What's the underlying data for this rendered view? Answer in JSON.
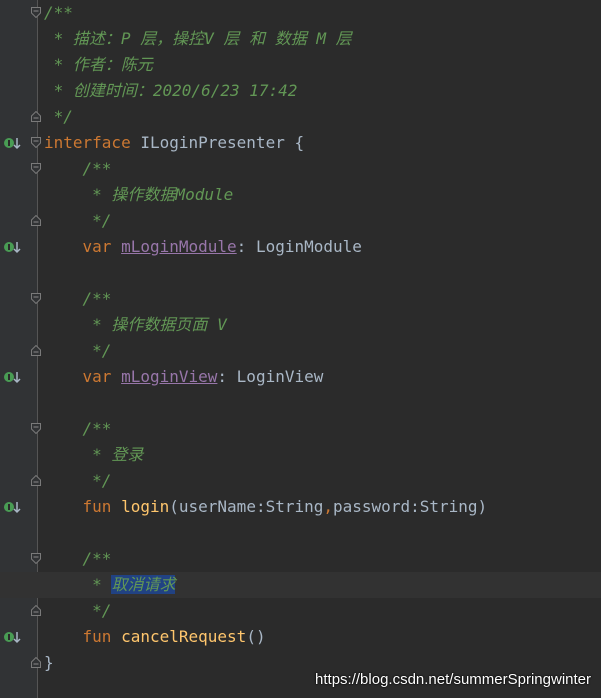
{
  "editor": {
    "lines": [
      {
        "segments": [
          {
            "text": "/**",
            "kind": "comment"
          }
        ]
      },
      {
        "segments": [
          {
            "text": " * 描述：P 层，操控V 层 和 数据 M 层",
            "kind": "comment"
          }
        ]
      },
      {
        "segments": [
          {
            "text": " * 作者：陈元",
            "kind": "comment"
          }
        ]
      },
      {
        "segments": [
          {
            "text": " * 创建时间：2020/6/23 17:42",
            "kind": "comment"
          }
        ]
      },
      {
        "segments": [
          {
            "text": " */",
            "kind": "comment"
          }
        ]
      },
      {
        "segments": [
          {
            "text": "interface",
            "kind": "keyword"
          },
          {
            "text": " ILoginPresenter {",
            "kind": "plain"
          }
        ]
      },
      {
        "segments": [
          {
            "text": "    /**",
            "kind": "comment"
          }
        ]
      },
      {
        "segments": [
          {
            "text": "     * 操作数据Module",
            "kind": "comment"
          }
        ]
      },
      {
        "segments": [
          {
            "text": "     */",
            "kind": "comment"
          }
        ]
      },
      {
        "segments": [
          {
            "text": "    ",
            "kind": "plain"
          },
          {
            "text": "var",
            "kind": "keyword"
          },
          {
            "text": " ",
            "kind": "plain"
          },
          {
            "text": "mLoginModule",
            "kind": "prop"
          },
          {
            "text": ": LoginModule",
            "kind": "plain"
          }
        ]
      },
      {
        "segments": []
      },
      {
        "segments": [
          {
            "text": "    /**",
            "kind": "comment"
          }
        ]
      },
      {
        "segments": [
          {
            "text": "     * 操作数据页面 V",
            "kind": "comment"
          }
        ]
      },
      {
        "segments": [
          {
            "text": "     */",
            "kind": "comment"
          }
        ]
      },
      {
        "segments": [
          {
            "text": "    ",
            "kind": "plain"
          },
          {
            "text": "var",
            "kind": "keyword"
          },
          {
            "text": " ",
            "kind": "plain"
          },
          {
            "text": "mLoginView",
            "kind": "prop"
          },
          {
            "text": ": LoginView",
            "kind": "plain"
          }
        ]
      },
      {
        "segments": []
      },
      {
        "segments": [
          {
            "text": "    /**",
            "kind": "comment"
          }
        ]
      },
      {
        "segments": [
          {
            "text": "     * 登录",
            "kind": "comment"
          }
        ]
      },
      {
        "segments": [
          {
            "text": "     */",
            "kind": "comment"
          }
        ]
      },
      {
        "segments": [
          {
            "text": "    ",
            "kind": "plain"
          },
          {
            "text": "fun",
            "kind": "keyword"
          },
          {
            "text": " ",
            "kind": "plain"
          },
          {
            "text": "login",
            "kind": "fn"
          },
          {
            "text": "(userName:String",
            "kind": "plain"
          },
          {
            "text": ",",
            "kind": "keyword"
          },
          {
            "text": "password:String)",
            "kind": "plain"
          }
        ]
      },
      {
        "segments": []
      },
      {
        "segments": [
          {
            "text": "    /**",
            "kind": "comment"
          }
        ]
      },
      {
        "segments": [
          {
            "text": "     * ",
            "kind": "comment"
          },
          {
            "text": "取消请求",
            "kind": "comment-selected"
          }
        ]
      },
      {
        "segments": [
          {
            "text": "     */",
            "kind": "comment"
          }
        ]
      },
      {
        "segments": [
          {
            "text": "    ",
            "kind": "plain"
          },
          {
            "text": "fun",
            "kind": "keyword"
          },
          {
            "text": " ",
            "kind": "plain"
          },
          {
            "text": "cancelRequest",
            "kind": "fn"
          },
          {
            "text": "()",
            "kind": "plain"
          }
        ]
      },
      {
        "segments": [
          {
            "text": "}",
            "kind": "plain"
          }
        ]
      }
    ],
    "current_line": 22,
    "fold_markers": {
      "0": "open",
      "4": "close",
      "5": "open",
      "6": "open",
      "8": "close",
      "11": "open",
      "13": "close",
      "16": "open",
      "18": "close",
      "21": "open",
      "23": "close",
      "25": "close"
    },
    "implement_markers": [
      5,
      9,
      14,
      19,
      24
    ],
    "colors": {
      "background": "#2b2b2b",
      "gutter": "#313335",
      "comment": "#629755",
      "keyword": "#cc7832",
      "property": "#9876aa",
      "function": "#ffc66d",
      "plain": "#a9b7c6",
      "selection": "#214283",
      "implement_icon": "#499c54"
    }
  },
  "watermark": {
    "text": "https://blog.csdn.net/summerSpringwinter"
  }
}
